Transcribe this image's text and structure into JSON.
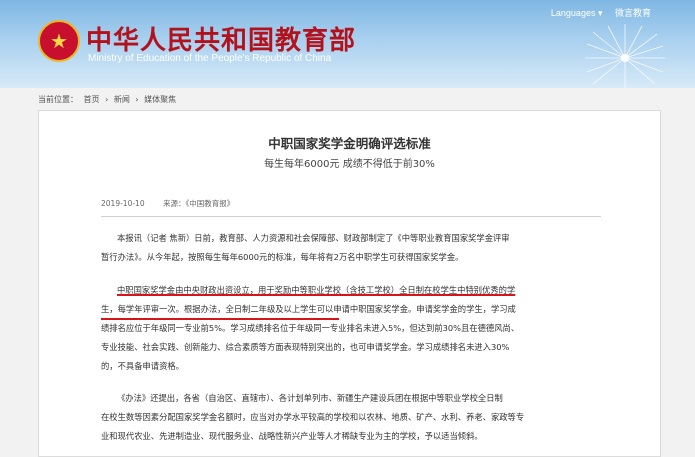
{
  "header": {
    "site_cn": "中华人民共和国教育部",
    "site_en": "Ministry of Education of the People's Republic of China",
    "links": [
      "Languages ▾",
      "微言教育"
    ]
  },
  "breadcrumb": {
    "label": "当前位置：",
    "items": [
      "首页",
      "新闻",
      "媒体聚焦"
    ],
    "separator": "›"
  },
  "article": {
    "title": "中职国家奖学金明确评选标准",
    "subtitle": "每生每年6000元 成绩不得低于前30%",
    "date": "2019-10-10",
    "source": "来源：《中国教育报》",
    "paragraphs": [
      [
        "本报讯（记者 焦新）日前，教育部、人力资源和社会保障部、财政部制定了《中等职业教育国家奖学金评审",
        "暂行办法》。从今年起，按照每生每年6000元的标准，每年将有2万名中职学生可获得国家奖学金。"
      ],
      [
        "中职国家奖学金由中央财政出资设立，用于奖励中等职业学校（含技工学校）全日制在校学生中特别优秀的学",
        "生，每学年评审一次。根据办法，全日制二年级及以上学生可以申请中职国家奖学金。申请奖学金的学生，学习成",
        "绩排名应位于年级同一专业前5%。学习成绩排名位于年级同一专业排名未进入5%，但达到前30%且在德德风尚、",
        "专业技能、社会实践、创新能力、综合素质等方面表现特别突出的，也可申请奖学金。学习成绩排名未进入30%",
        "的，不具备申请资格。"
      ],
      [
        "《办法》还提出，各省（自治区、直辖市）、各计划单列市、新疆生产建设兵团在根据中等职业学校全日制",
        "在校生数等因素分配国家奖学金名额时，应当对办学水平较高的学校和以农林、地质、矿产、水利、养老、家政等专",
        "业和现代农业、先进制造业、现代服务业、战略性新兴产业等人才稀缺专业为主的学校，予以适当倾斜。"
      ]
    ]
  },
  "colors": {
    "brand_red": "#b3121c",
    "highlight_red": "#d8141a",
    "header_blue": "#7fb7e3"
  }
}
